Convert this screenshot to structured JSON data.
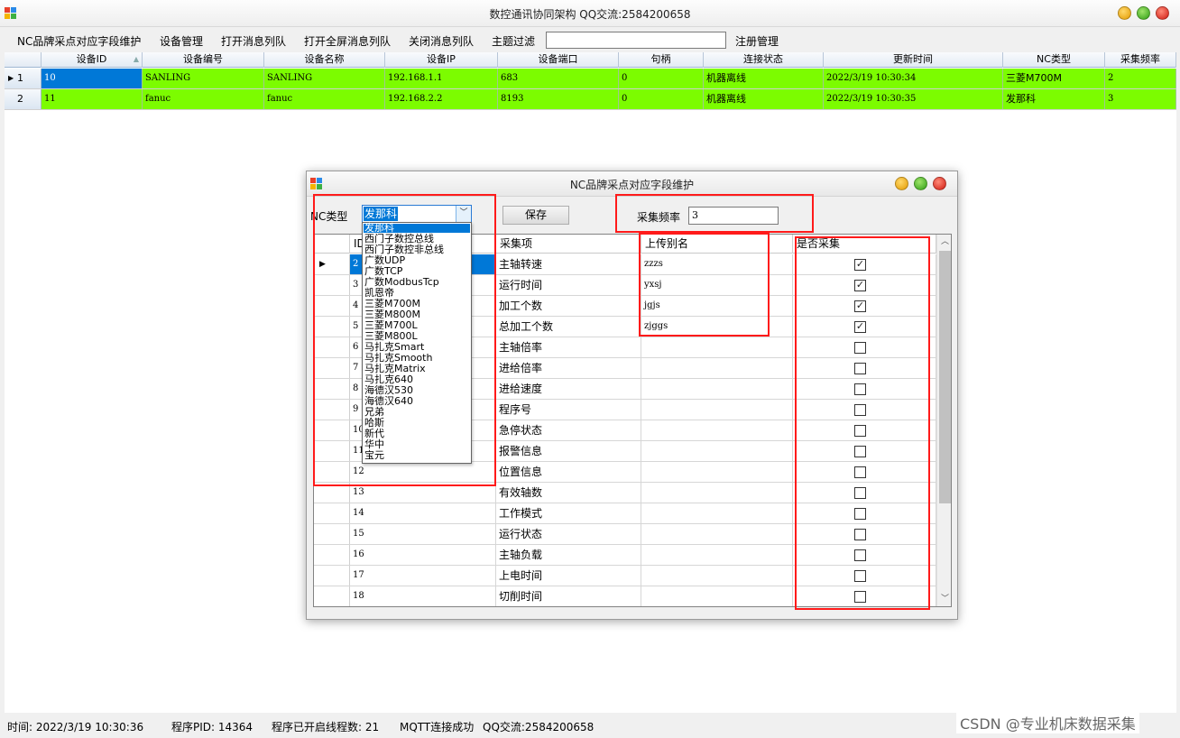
{
  "app": {
    "title": "数控通讯协同架构 QQ交流:2584200658"
  },
  "menu": {
    "items": [
      "NC品牌采点对应字段维护",
      "设备管理",
      "打开消息列队",
      "打开全屏消息列队",
      "关闭消息列队",
      "主题过滤",
      "注册管理"
    ],
    "topic_filter_value": ""
  },
  "main_grid": {
    "columns": [
      "设备ID",
      "设备编号",
      "设备名称",
      "设备IP",
      "设备端口",
      "句柄",
      "连接状态",
      "更新时间",
      "NC类型",
      "采集频率"
    ],
    "rows": [
      {
        "row_no": "1",
        "cells": [
          "10",
          "SANLING",
          "SANLING",
          "192.168.1.1",
          "683",
          "0",
          "机器离线",
          "2022/3/19 10:30:34",
          "三菱M700M",
          "2"
        ]
      },
      {
        "row_no": "2",
        "cells": [
          "11",
          "fanuc",
          "fanuc",
          "192.168.2.2",
          "8193",
          "0",
          "机器离线",
          "2022/3/19 10:30:35",
          "发那科",
          "3"
        ]
      }
    ],
    "row_color": "#7cfc00"
  },
  "dialog": {
    "title": "NC品牌采点对应字段维护",
    "nc_type_label": "NC类型",
    "nc_type_value": "发那科",
    "save_label": "保存",
    "freq_label": "采集频率",
    "freq_value": "3",
    "grid": {
      "columns": [
        "ID",
        "采集项",
        "上传别名",
        "是否采集"
      ],
      "rows": [
        {
          "id": "2",
          "item": "主轴转速",
          "alias": "zzzs",
          "checked": true
        },
        {
          "id": "3",
          "item": "运行时间",
          "alias": "yxsj",
          "checked": true
        },
        {
          "id": "4",
          "item": "加工个数",
          "alias": "jgjs",
          "checked": true
        },
        {
          "id": "5",
          "item": "总加工个数",
          "alias": "zjggs",
          "checked": true
        },
        {
          "id": "6",
          "item": "主轴倍率",
          "alias": "",
          "checked": false
        },
        {
          "id": "7",
          "item": "进给倍率",
          "alias": "",
          "checked": false
        },
        {
          "id": "8",
          "item": "进给速度",
          "alias": "",
          "checked": false
        },
        {
          "id": "9",
          "item": "程序号",
          "alias": "",
          "checked": false
        },
        {
          "id": "10",
          "item": "急停状态",
          "alias": "",
          "checked": false
        },
        {
          "id": "11",
          "item": "报警信息",
          "alias": "",
          "checked": false
        },
        {
          "id": "12",
          "item": "位置信息",
          "alias": "",
          "checked": false
        },
        {
          "id": "13",
          "item": "有效轴数",
          "alias": "",
          "checked": false
        },
        {
          "id": "14",
          "item": "工作模式",
          "alias": "",
          "checked": false
        },
        {
          "id": "15",
          "item": "运行状态",
          "alias": "",
          "checked": false
        },
        {
          "id": "16",
          "item": "主轴负载",
          "alias": "",
          "checked": false
        },
        {
          "id": "17",
          "item": "上电时间",
          "alias": "",
          "checked": false
        },
        {
          "id": "18",
          "item": "切削时间",
          "alias": "",
          "checked": false
        }
      ]
    },
    "dropdown_options": [
      "发那科",
      "西门子数控总线",
      "西门子数控非总线",
      "广数UDP",
      "广数TCP",
      "广数ModbusTcp",
      "凯恩帝",
      "三菱M700M",
      "三菱M800M",
      "三菱M700L",
      "三菱M800L",
      "马扎克Smart",
      "马扎克Smooth",
      "马扎克Matrix",
      "马扎克640",
      "海德汉530",
      "海德汉640",
      "兄弟",
      "哈斯",
      "新代",
      "华中",
      "宝元"
    ],
    "dropdown_selected_index": 0
  },
  "status_bar": {
    "time": "时间: 2022/3/19 10:30:36",
    "pid": "程序PID: 14364",
    "threads": "程序已开启线程数: 21",
    "mqtt": "MQTT连接成功",
    "qq": "QQ交流:2584200658"
  },
  "watermark": "CSDN @专业机床数据采集",
  "colors": {
    "selection": "#0078d7",
    "row_green": "#7cfc00",
    "annotation_red": "#ff1a1a"
  }
}
